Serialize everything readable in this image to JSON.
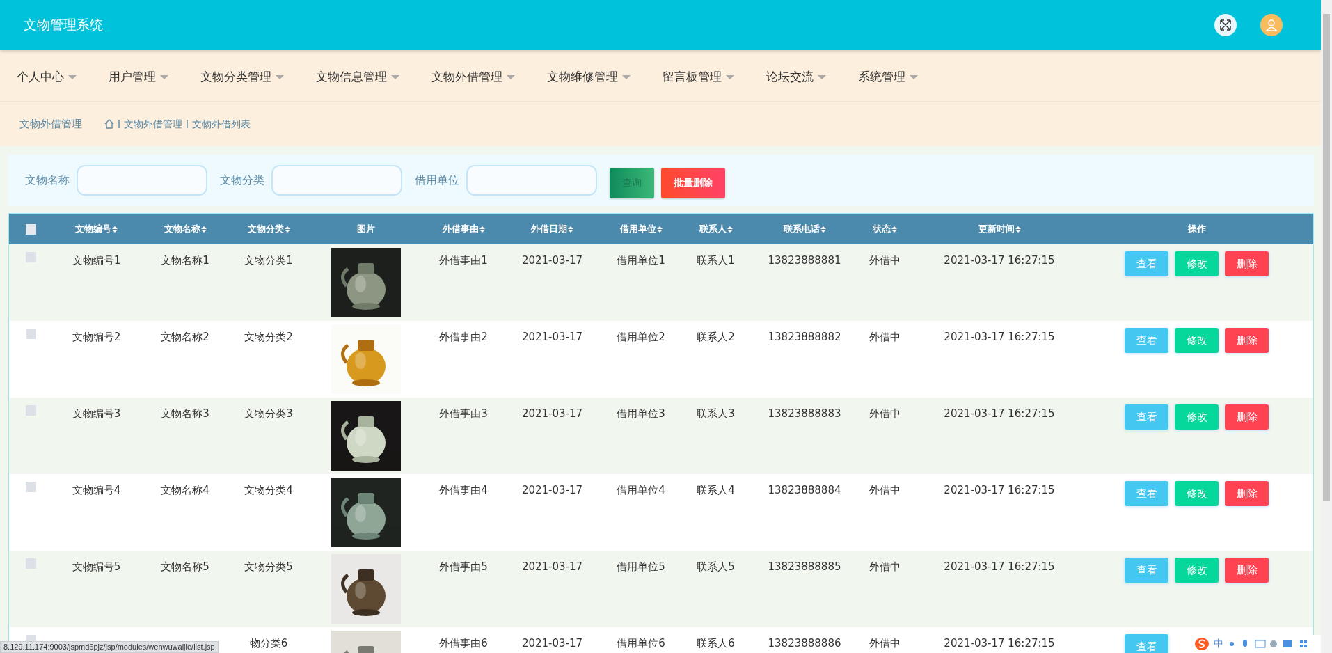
{
  "header": {
    "title": "文物管理系统"
  },
  "nav": [
    {
      "label": "个人中心"
    },
    {
      "label": "用户管理"
    },
    {
      "label": "文物分类管理"
    },
    {
      "label": "文物信息管理"
    },
    {
      "label": "文物外借管理"
    },
    {
      "label": "文物维修管理"
    },
    {
      "label": "留言板管理"
    },
    {
      "label": "论坛交流"
    },
    {
      "label": "系统管理"
    }
  ],
  "breadcrumb": {
    "title": "文物外借管理",
    "path": [
      "文物外借管理",
      "文物外借列表"
    ]
  },
  "search": {
    "fields": [
      {
        "label": "文物名称"
      },
      {
        "label": "文物分类"
      },
      {
        "label": "借用单位"
      }
    ],
    "buttons": [
      {
        "label": "查询",
        "kind": "query"
      },
      {
        "label": "批量删除",
        "kind": "delete"
      }
    ]
  },
  "table": {
    "select_all": {
      "checked": false
    },
    "columns": [
      {
        "label": "文物编号",
        "sortable": true
      },
      {
        "label": "文物名称",
        "sortable": true
      },
      {
        "label": "文物分类",
        "sortable": true
      },
      {
        "label": "图片",
        "sortable": false
      },
      {
        "label": "外借事由",
        "sortable": true
      },
      {
        "label": "外借日期",
        "sortable": true
      },
      {
        "label": "借用单位",
        "sortable": true
      },
      {
        "label": "联系人",
        "sortable": true
      },
      {
        "label": "联系电话",
        "sortable": true
      },
      {
        "label": "状态",
        "sortable": true
      },
      {
        "label": "更新时间",
        "sortable": true
      },
      {
        "label": "操作",
        "sortable": false
      }
    ],
    "rows": [
      {
        "checked": false,
        "id": "文物编号1",
        "name": "文物名称1",
        "category": "文物分类1",
        "image": {
          "kind": "picture"
        },
        "reason": "外借事由1",
        "date": "2021-03-17",
        "unit": "借用单位1",
        "contact": "联系人1",
        "phone": "13823888881",
        "status": "外借中",
        "updated": "2021-03-17 16:27:15",
        "actions": [
          {
            "label": "查看",
            "kind": "view"
          },
          {
            "label": "修改",
            "kind": "edit"
          },
          {
            "label": "删除",
            "kind": "delete"
          }
        ]
      },
      {
        "checked": false,
        "id": "文物编号2",
        "name": "文物名称2",
        "category": "文物分类2",
        "image": {
          "kind": "picture"
        },
        "reason": "外借事由2",
        "date": "2021-03-17",
        "unit": "借用单位2",
        "contact": "联系人2",
        "phone": "13823888882",
        "status": "外借中",
        "updated": "2021-03-17 16:27:15",
        "actions": [
          {
            "label": "查看",
            "kind": "view"
          },
          {
            "label": "修改",
            "kind": "edit"
          },
          {
            "label": "删除",
            "kind": "delete"
          }
        ]
      },
      {
        "checked": false,
        "id": "文物编号3",
        "name": "文物名称3",
        "category": "文物分类3",
        "image": {
          "kind": "picture"
        },
        "reason": "外借事由3",
        "date": "2021-03-17",
        "unit": "借用单位3",
        "contact": "联系人3",
        "phone": "13823888883",
        "status": "外借中",
        "updated": "2021-03-17 16:27:15",
        "actions": [
          {
            "label": "查看",
            "kind": "view"
          },
          {
            "label": "修改",
            "kind": "edit"
          },
          {
            "label": "删除",
            "kind": "delete"
          }
        ]
      },
      {
        "checked": false,
        "id": "文物编号4",
        "name": "文物名称4",
        "category": "文物分类4",
        "image": {
          "kind": "picture"
        },
        "reason": "外借事由4",
        "date": "2021-03-17",
        "unit": "借用单位4",
        "contact": "联系人4",
        "phone": "13823888884",
        "status": "外借中",
        "updated": "2021-03-17 16:27:15",
        "actions": [
          {
            "label": "查看",
            "kind": "view"
          },
          {
            "label": "修改",
            "kind": "edit"
          },
          {
            "label": "删除",
            "kind": "delete"
          }
        ]
      },
      {
        "checked": false,
        "id": "文物编号5",
        "name": "文物名称5",
        "category": "文物分类5",
        "image": {
          "kind": "picture"
        },
        "reason": "外借事由5",
        "date": "2021-03-17",
        "unit": "借用单位5",
        "contact": "联系人5",
        "phone": "13823888885",
        "status": "外借中",
        "updated": "2021-03-17 16:27:15",
        "actions": [
          {
            "label": "查看",
            "kind": "view"
          },
          {
            "label": "修改",
            "kind": "edit"
          },
          {
            "label": "删除",
            "kind": "delete"
          }
        ]
      },
      {
        "checked": false,
        "category": "物分类6",
        "image": {
          "kind": "picture"
        },
        "reason": "外借事由6",
        "date": "2021-03-17",
        "unit": "借用单位6",
        "contact": "联系人6",
        "phone": "13823888886",
        "status": "外借中",
        "updated": "2021-03-17 16:27:15",
        "actions": [
          {
            "label": "查看",
            "kind": "view"
          }
        ]
      }
    ]
  },
  "status_bar": {
    "url": "8.129.11.174:9003/jspmd6pjz/jsp/modules/wenwuwaijie/list.jsp"
  },
  "ime_bar": {
    "mode": "中"
  }
}
